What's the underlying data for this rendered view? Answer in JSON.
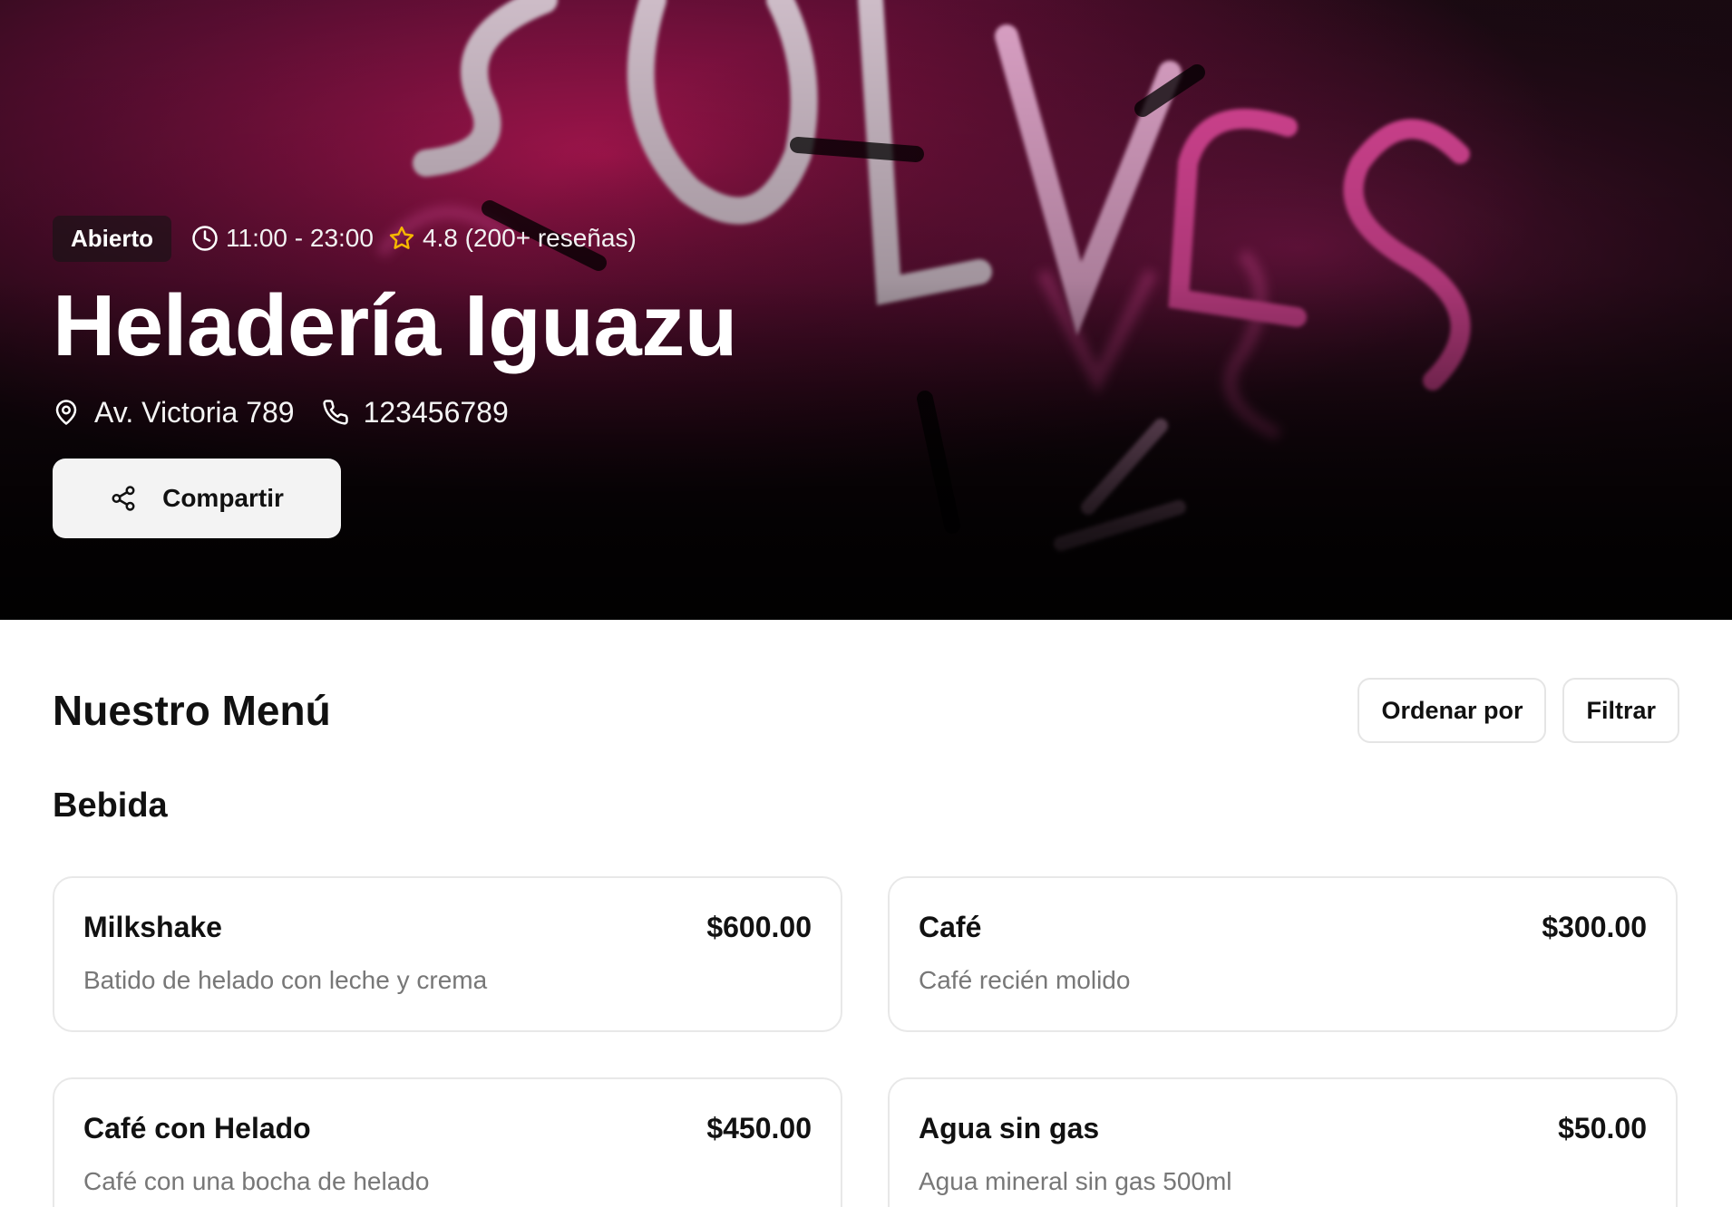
{
  "hero": {
    "status_badge": "Abierto",
    "hours": "11:00 - 23:00",
    "rating": "4.8 (200+ reseñas)",
    "name": "Heladería Iguazu",
    "address": "Av. Victoria 789",
    "phone": "123456789",
    "share_label": "Compartir",
    "background_sign_text": "SOLVES",
    "icons": {
      "hours": "clock-icon",
      "rating": "star-icon",
      "address": "map-pin-icon",
      "phone": "phone-icon",
      "share": "share-icon"
    },
    "colors": {
      "star": "#f5b800",
      "neon": "#e64a9e"
    }
  },
  "menu": {
    "title": "Nuestro Menú",
    "sort_label": "Ordenar por",
    "filter_label": "Filtrar",
    "categories": [
      {
        "name": "Bebida",
        "items": [
          {
            "name": "Milkshake",
            "price": "$600.00",
            "description": "Batido de helado con leche y crema"
          },
          {
            "name": "Café",
            "price": "$300.00",
            "description": "Café recién molido"
          },
          {
            "name": "Café con Helado",
            "price": "$450.00",
            "description": "Café con una bocha de helado"
          },
          {
            "name": "Agua sin gas",
            "price": "$50.00",
            "description": "Agua mineral sin gas 500ml"
          }
        ]
      }
    ]
  }
}
